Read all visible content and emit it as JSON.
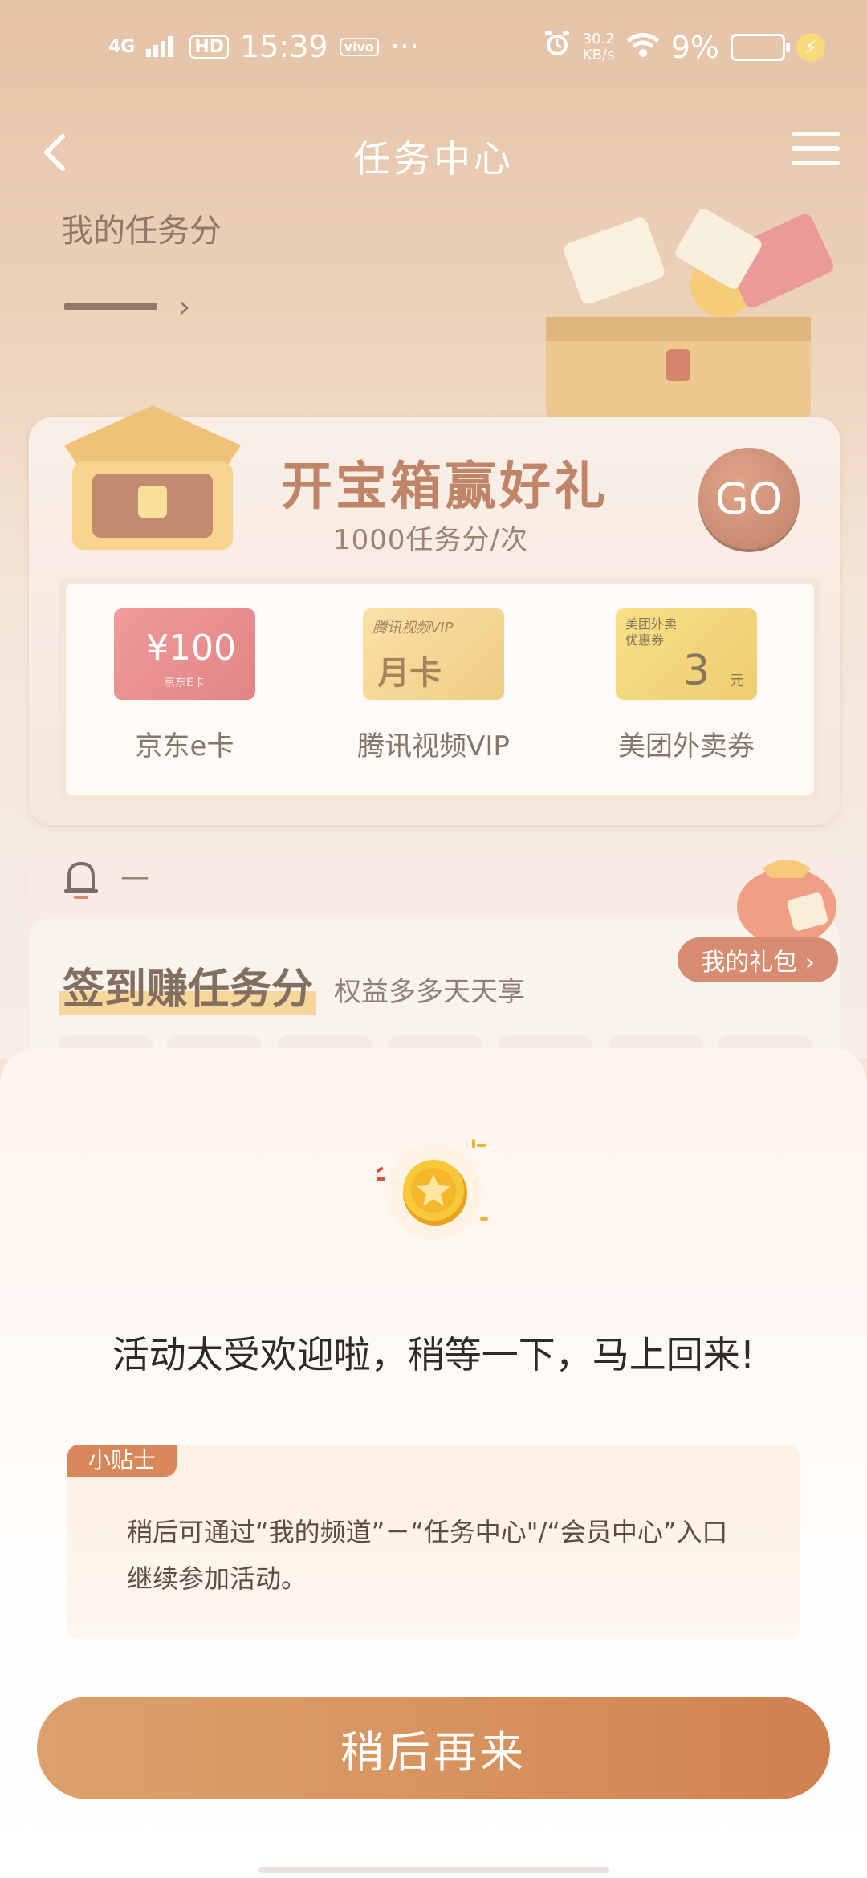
{
  "status_bar": {
    "signal": "4G",
    "hd": "HD",
    "time": "15:39",
    "carrier_badge": "vivo",
    "more": "···",
    "net_speed_value": "30.2",
    "net_speed_unit": "KB/s",
    "battery_percent": "9%"
  },
  "nav": {
    "title": "任务中心"
  },
  "my_score": {
    "label": "我的任务分"
  },
  "treasure": {
    "title": "开宝箱赢好礼",
    "subtitle": "1000任务分/次",
    "go_label": "GO",
    "prizes": [
      {
        "label": "京东e卡",
        "card_amount": "¥100",
        "card_sub": "京东E卡"
      },
      {
        "label": "腾讯视频VIP",
        "card_logo": "腾讯视频VIP",
        "card_main": "月卡"
      },
      {
        "label": "美团外卖券",
        "card_title_1": "美团外卖",
        "card_title_2": "优惠券",
        "card_value": "3",
        "card_unit": "元"
      }
    ]
  },
  "signin": {
    "notice_dash": "—",
    "title": "签到赚任务分",
    "subtitle": "权益多多天天享",
    "gift_button": "我的礼包 ›"
  },
  "sheet": {
    "message": "活动太受欢迎啦，稍等一下，马上回来!",
    "tip_tag": "小贴士",
    "tip_text": "稍后可通过“我的频道”－“任务中心\"/“会员中心”入口继续参加活动。",
    "button_label": "稍后再来"
  },
  "colors": {
    "accent": "#d7945f",
    "go_button": "#a24725",
    "tip_tag": "#d8875a"
  }
}
